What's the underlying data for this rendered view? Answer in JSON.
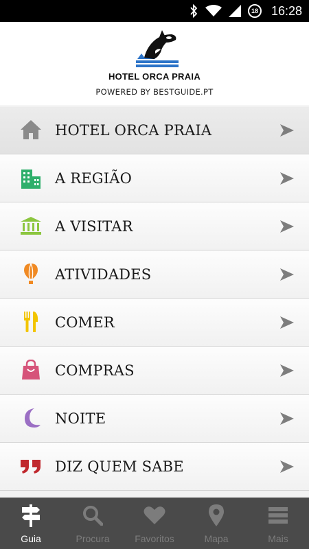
{
  "status_bar": {
    "time": "16:28",
    "notification_count": "18",
    "icons": [
      "bluetooth-icon",
      "wifi-icon",
      "signal-icon",
      "alarm-badge-icon"
    ]
  },
  "header": {
    "logo_icon": "orca-logo",
    "title": "HOTEL ORCA PRAIA",
    "subtitle": "POWERED BY BESTGUIDE.PT"
  },
  "menu": {
    "items": [
      {
        "label": "HOTEL ORCA PRAIA",
        "icon": "home-icon",
        "color": "#8a8a8a"
      },
      {
        "label": "A REGIÃO",
        "icon": "buildings-icon",
        "color": "#2eaf6b"
      },
      {
        "label": "A VISITAR",
        "icon": "monument-icon",
        "color": "#8cc63f"
      },
      {
        "label": "ATIVIDADES",
        "icon": "hot-air-balloon-icon",
        "color": "#f08a24"
      },
      {
        "label": "COMER",
        "icon": "fork-knife-icon",
        "color": "#f2c500"
      },
      {
        "label": "COMPRAS",
        "icon": "shopping-bag-icon",
        "color": "#d6537a"
      },
      {
        "label": "NOITE",
        "icon": "moon-icon",
        "color": "#9b6fc4"
      },
      {
        "label": "DIZ QUEM SABE",
        "icon": "quote-icon",
        "color": "#c0282d"
      }
    ],
    "arrow_color": "#7d7d7d"
  },
  "bottom_nav": {
    "tabs": [
      {
        "label": "Guia",
        "icon": "signpost-icon",
        "active": true
      },
      {
        "label": "Procura",
        "icon": "search-icon",
        "active": false
      },
      {
        "label": "Favoritos",
        "icon": "heart-icon",
        "active": false
      },
      {
        "label": "Mapa",
        "icon": "map-pin-icon",
        "active": false
      },
      {
        "label": "Mais",
        "icon": "menu-icon",
        "active": false
      }
    ]
  }
}
